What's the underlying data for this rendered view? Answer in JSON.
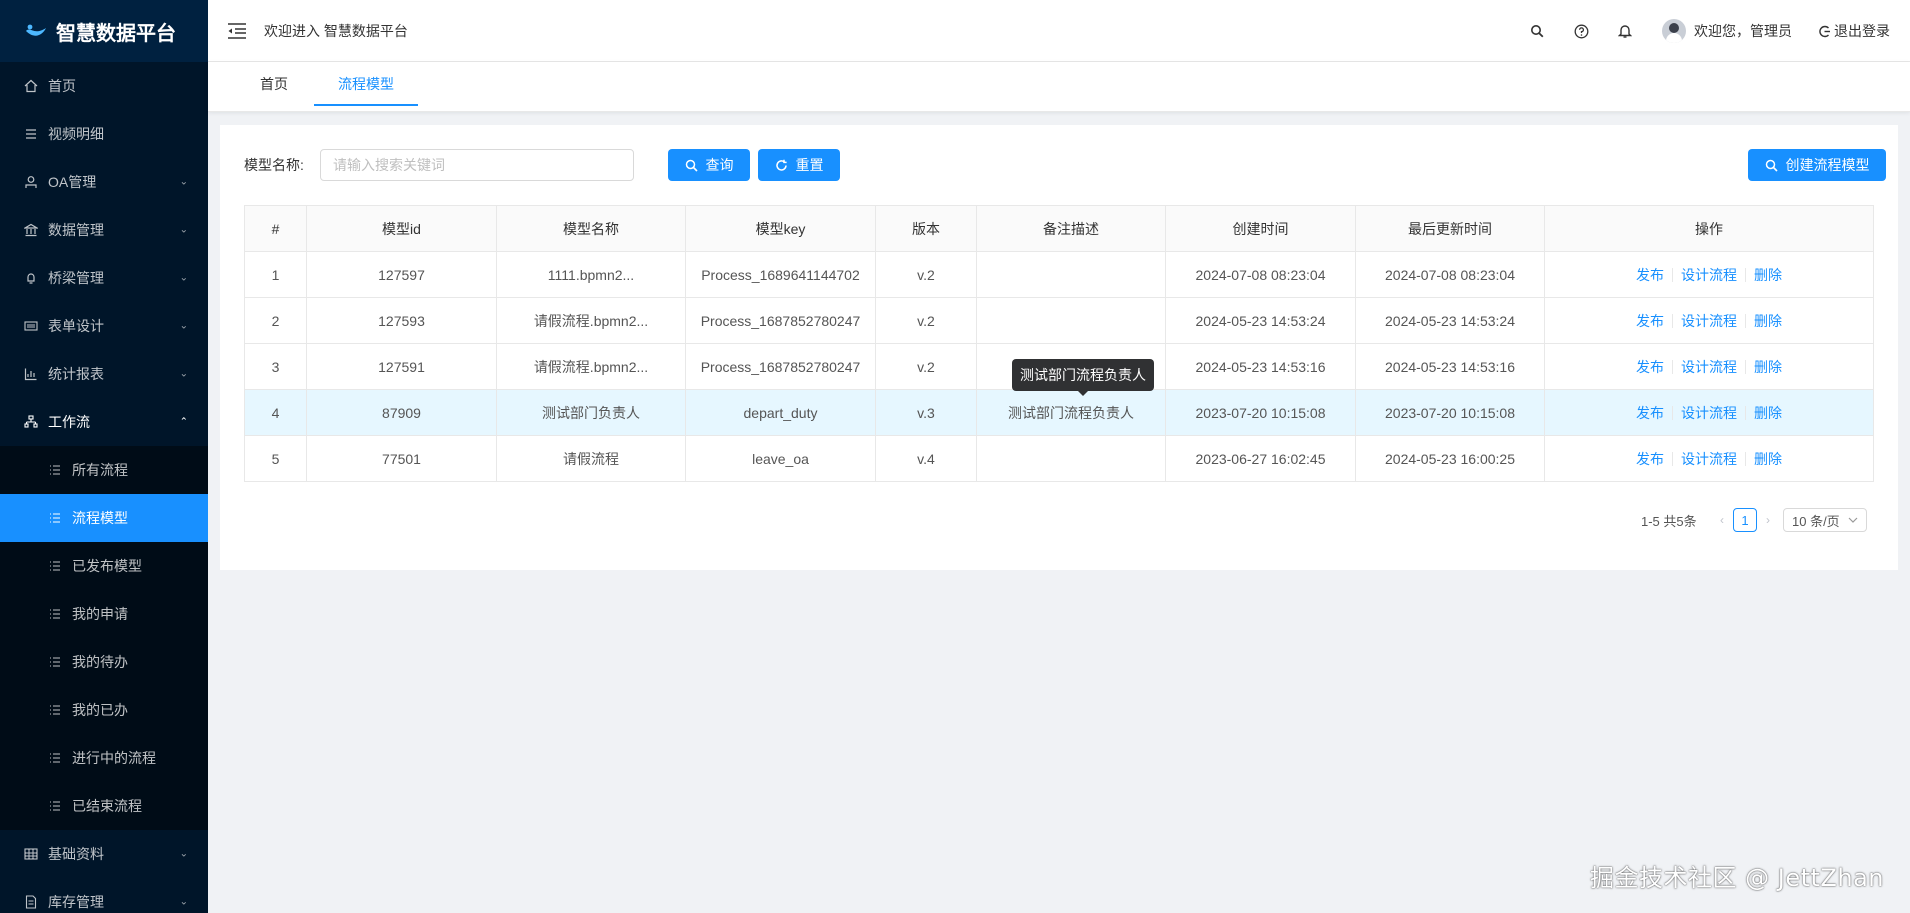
{
  "app": {
    "title": "智慧数据平台"
  },
  "sidebar": {
    "items": [
      {
        "label": "首页",
        "icon": "home-icon"
      },
      {
        "label": "视频明细",
        "icon": "list-icon"
      },
      {
        "label": "OA管理",
        "icon": "user-icon",
        "expandable": true
      },
      {
        "label": "数据管理",
        "icon": "bank-icon",
        "expandable": true
      },
      {
        "label": "桥梁管理",
        "icon": "bell-icon",
        "expandable": true
      },
      {
        "label": "表单设计",
        "icon": "barcode-icon",
        "expandable": true
      },
      {
        "label": "统计报表",
        "icon": "bar-chart-icon",
        "expandable": true
      },
      {
        "label": "工作流",
        "icon": "flow-icon",
        "expandable": true,
        "open": true
      }
    ],
    "workflow_children": [
      {
        "label": "所有流程"
      },
      {
        "label": "流程模型",
        "active": true
      },
      {
        "label": "已发布模型"
      },
      {
        "label": "我的申请"
      },
      {
        "label": "我的待办"
      },
      {
        "label": "我的已办"
      },
      {
        "label": "进行中的流程"
      },
      {
        "label": "已结束流程"
      }
    ],
    "bottom_items": [
      {
        "label": "基础资料",
        "icon": "table-icon",
        "expandable": true
      },
      {
        "label": "库存管理",
        "icon": "file-icon",
        "expandable": true
      }
    ]
  },
  "header": {
    "welcome": "欢迎进入 智慧数据平台",
    "user_greeting": "欢迎您，管理员",
    "logout": "退出登录"
  },
  "tabs": [
    {
      "label": "首页",
      "active": false
    },
    {
      "label": "流程模型",
      "active": true
    }
  ],
  "search": {
    "label": "模型名称:",
    "placeholder": "请输入搜索关键词",
    "value": "",
    "query_label": "查询",
    "reset_label": "重置",
    "create_label": "创建流程模型"
  },
  "table": {
    "columns": [
      "#",
      "模型id",
      "模型名称",
      "模型key",
      "版本",
      "备注描述",
      "创建时间",
      "最后更新时间",
      "操作"
    ],
    "rows": [
      {
        "no": "1",
        "id": "127597",
        "name": "1111.bpmn2...",
        "key": "Process_1689641144702",
        "version": "v.2",
        "desc": "",
        "created": "2024-07-08 08:23:04",
        "updated": "2024-07-08 08:23:04"
      },
      {
        "no": "2",
        "id": "127593",
        "name": "请假流程.bpmn2...",
        "key": "Process_1687852780247",
        "version": "v.2",
        "desc": "",
        "created": "2024-05-23 14:53:24",
        "updated": "2024-05-23 14:53:24"
      },
      {
        "no": "3",
        "id": "127591",
        "name": "请假流程.bpmn2...",
        "key": "Process_1687852780247",
        "version": "v.2",
        "desc": "",
        "created": "2024-05-23 14:53:16",
        "updated": "2024-05-23 14:53:16"
      },
      {
        "no": "4",
        "id": "87909",
        "name": "测试部门负责人",
        "key": "depart_duty",
        "version": "v.3",
        "desc": "测试部门流程负责人",
        "created": "2023-07-20 10:15:08",
        "updated": "2023-07-20 10:15:08",
        "highlighted": true
      },
      {
        "no": "5",
        "id": "77501",
        "name": "请假流程",
        "key": "leave_oa",
        "version": "v.4",
        "desc": "",
        "created": "2023-06-27 16:02:45",
        "updated": "2024-05-23 16:00:25"
      }
    ],
    "actions": [
      "发布",
      "设计流程",
      "删除"
    ]
  },
  "tooltip": {
    "text": "测试部门流程负责人"
  },
  "pagination": {
    "total_text": "1-5 共5条",
    "current_page": "1",
    "page_size": "10 条/页"
  },
  "watermark": "掘金技术社区 @ JettZhan",
  "colors": {
    "primary": "#1890ff",
    "sidebar_bg": "#001529",
    "sub_menu_bg": "#000c17",
    "row_highlight": "#e6f7ff"
  }
}
